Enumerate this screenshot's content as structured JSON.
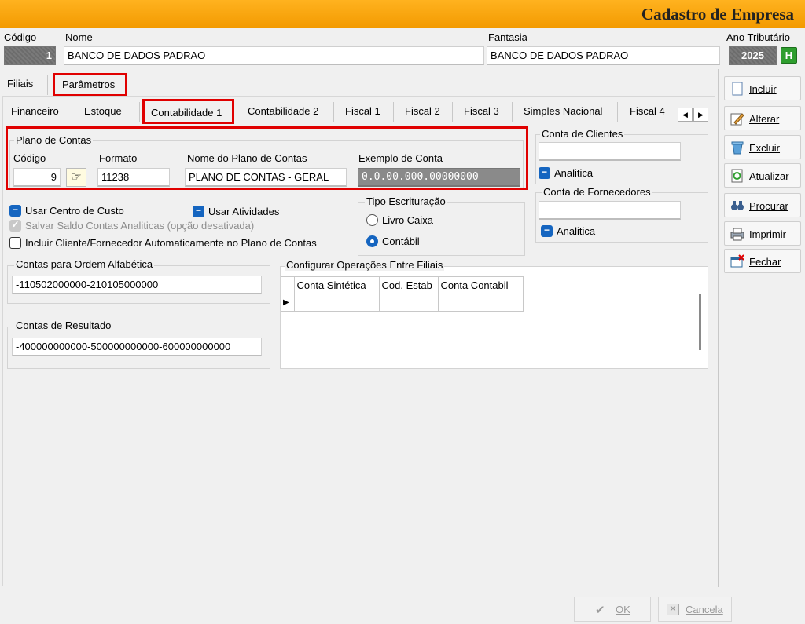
{
  "window": {
    "title": "Cadastro de Empresa"
  },
  "header": {
    "codigo_label": "Código",
    "codigo_value": "1",
    "nome_label": "Nome",
    "nome_value": "BANCO DE DADOS PADRAO",
    "fantasia_label": "Fantasia",
    "fantasia_value": "BANCO DE DADOS PADRAO",
    "ano_label": "Ano Tributário",
    "ano_value": "2025",
    "ano_button": "H"
  },
  "top_tabs": [
    "Filiais",
    "Parâmetros"
  ],
  "sub_tabs": [
    "Financeiro",
    "Estoque",
    "Contabilidade 1",
    "Contabilidade 2",
    "Fiscal 1",
    "Fiscal 2",
    "Fiscal 3",
    "Simples Nacional",
    "Fiscal 4"
  ],
  "plano": {
    "title": "Plano de Contas",
    "codigo_label": "Código",
    "codigo_value": "9",
    "formato_label": "Formato",
    "formato_value": "11238",
    "nome_label": "Nome do Plano de Contas",
    "nome_value": "PLANO DE CONTAS - GERAL",
    "exemplo_label": "Exemplo de Conta",
    "exemplo_value": "0.0.00.000.00000000"
  },
  "conta_clientes": {
    "title": "Conta de Clientes",
    "value": "",
    "analitica": "Analitica"
  },
  "conta_fornecedores": {
    "title": "Conta de Fornecedores",
    "value": "",
    "analitica": "Analitica"
  },
  "options": {
    "centro_custo": "Usar Centro de Custo",
    "atividades": "Usar Atividades",
    "salvar_saldo": "Salvar Saldo  Contas Analiticas (opção desativada)",
    "incluir_cliente": "Incluir Cliente/Fornecedor Automaticamente no Plano de Contas"
  },
  "escrituracao": {
    "title": "Tipo Escrituração",
    "livro": "Livro Caixa",
    "contabil": "Contábil",
    "selected": "Contábil"
  },
  "ordem_alfabetica": {
    "title": "Contas para Ordem  Alfabética",
    "value": "-110502000000-210105000000"
  },
  "resultado": {
    "title": "Contas de Resultado",
    "value": "-400000000000-500000000000-600000000000"
  },
  "filiais_ops": {
    "title": "Configurar Operações Entre Filiais",
    "columns": [
      "Conta Sintética",
      "Cod. Estab",
      "Conta Contabil"
    ]
  },
  "side_buttons": [
    "Incluir",
    "Alterar",
    "Excluir",
    "Atualizar",
    "Procurar",
    "Imprimir",
    "Fechar"
  ],
  "bottom": {
    "ok": "OK",
    "cancel": "Cancela"
  }
}
